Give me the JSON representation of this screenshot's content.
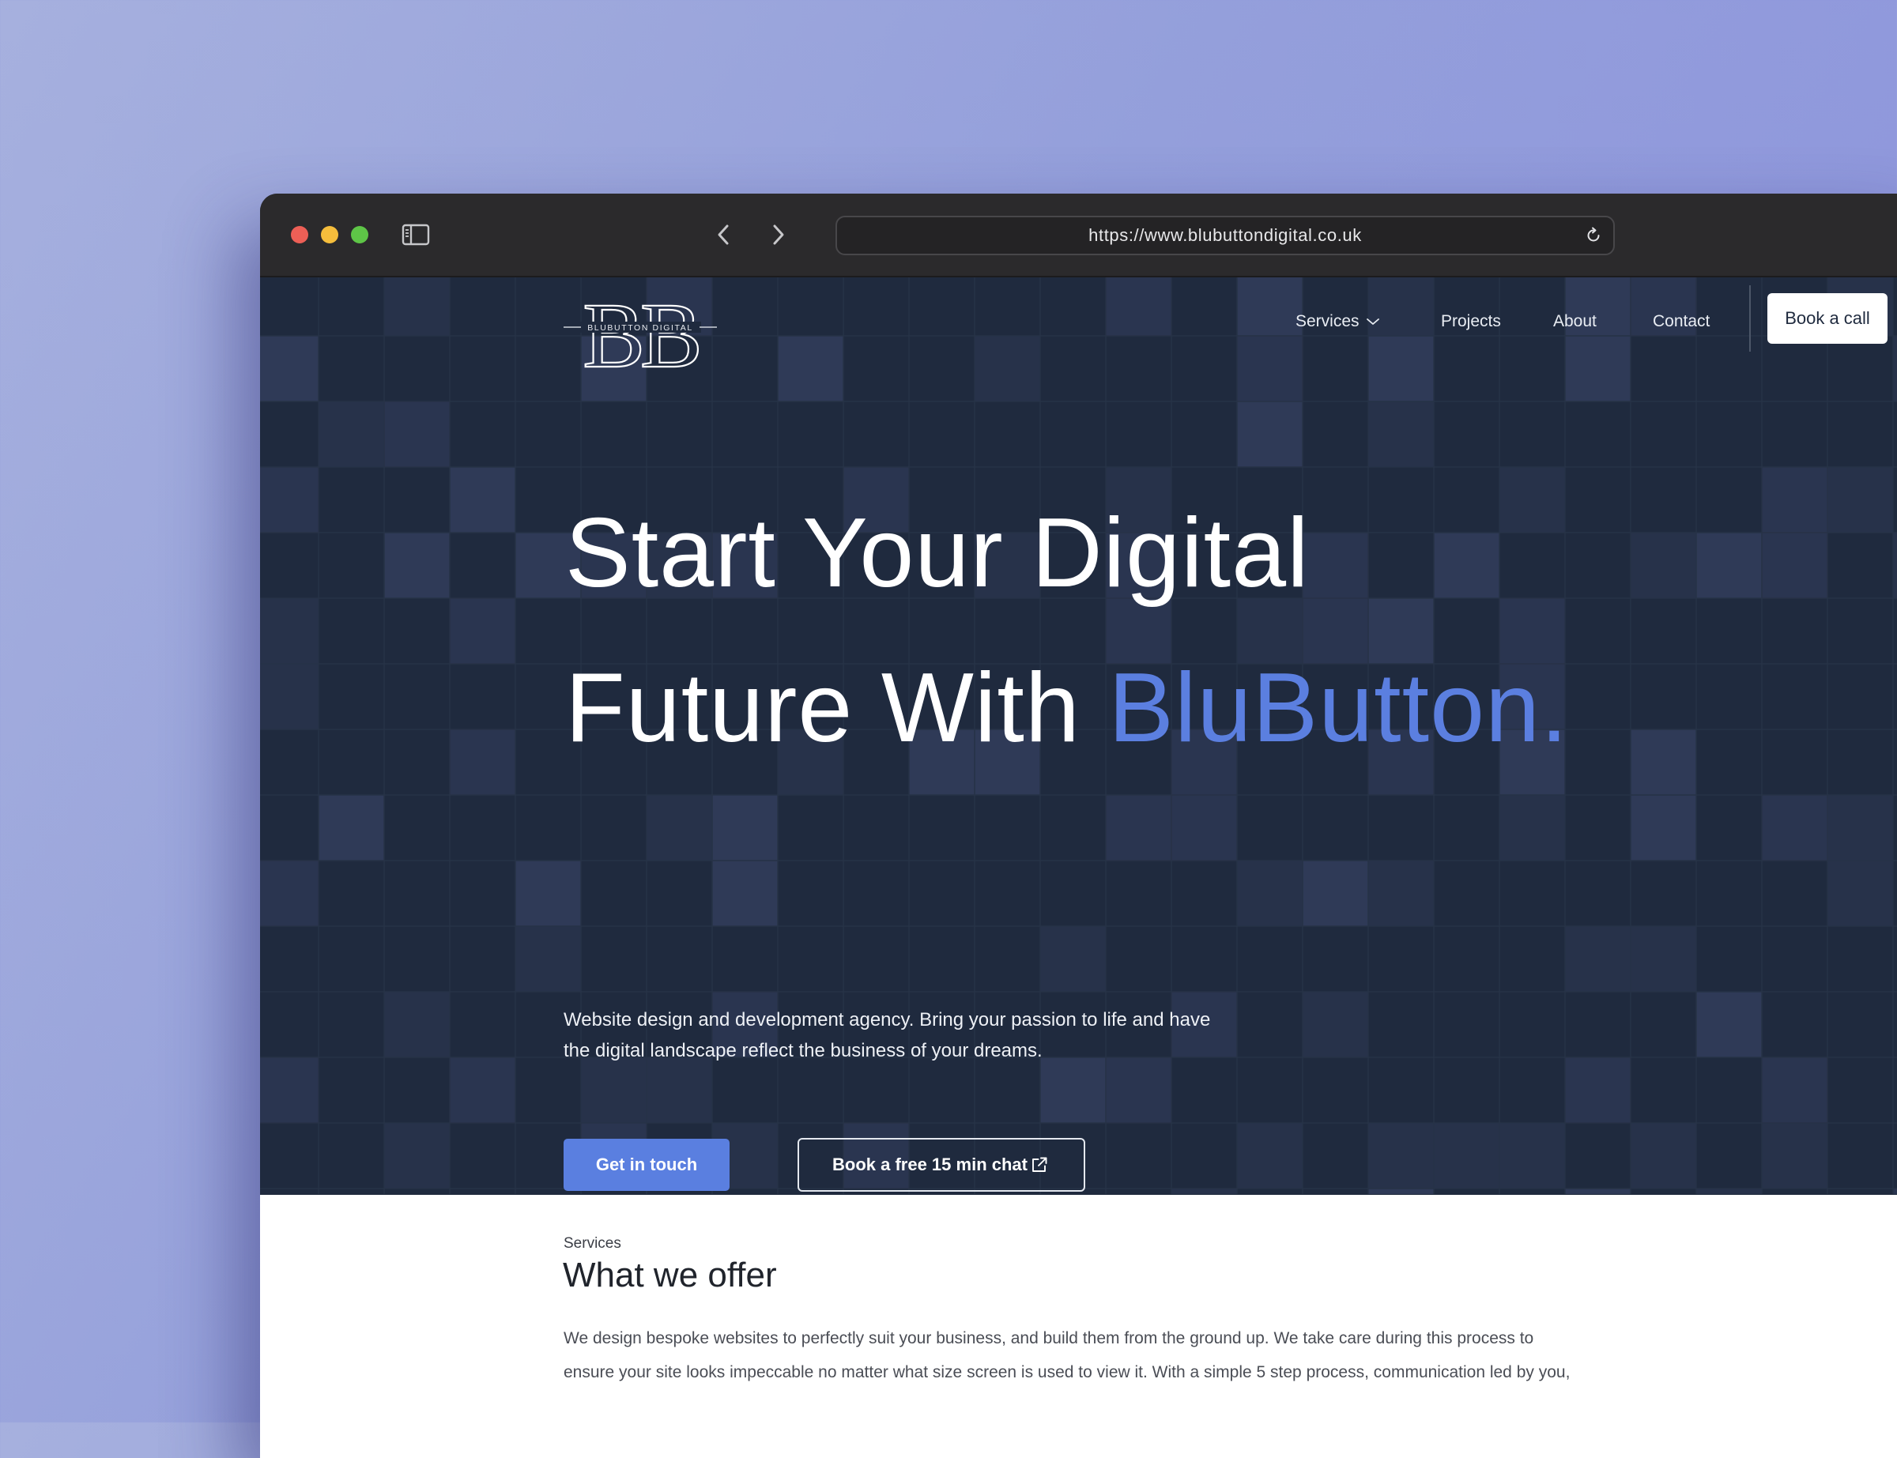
{
  "browser": {
    "url": "https://www.blubuttondigital.co.uk",
    "icons": [
      "red-close-light",
      "yellow-minimize-light",
      "green-zoom-light",
      "sidebar-icon",
      "back-arrow-icon",
      "forward-arrow-icon",
      "reload-icon"
    ]
  },
  "logo": {
    "monogram": "BB",
    "wordmark": "BLUBUTTON DIGITAL"
  },
  "nav": {
    "items": [
      {
        "label": "Services",
        "icon": "chevron-down-icon"
      },
      {
        "label": "Projects"
      },
      {
        "label": "About"
      },
      {
        "label": "Contact"
      }
    ],
    "cta_label": "Book a call"
  },
  "hero": {
    "headline_line1": "Start Your Digital",
    "headline_line2_prefix": "Future With ",
    "headline_accent": "BluButton.",
    "subtext_line1": "Website design and development agency. Bring your passion to life and have",
    "subtext_line2": "the digital landscape reflect the business of your dreams.",
    "primary_button": "Get in touch",
    "secondary_button": "Book a free 15 min chat",
    "secondary_icon": "external-link-icon"
  },
  "services": {
    "kicker": "Services",
    "title": "What we offer",
    "body_line1": "We design bespoke websites to perfectly suit your business, and build them from the ground up. We take care during this process to",
    "body_line2": "ensure your site looks impeccable no matter what size screen is used to view it. With a simple 5 step process, communication led by you,"
  },
  "colors": {
    "hero_background": "#1f2a3e",
    "accent": "#5b7fe0",
    "titlebar": "#2b2a2c",
    "page_background_start": "#a6b0de",
    "page_background_end": "#8c92dd"
  }
}
